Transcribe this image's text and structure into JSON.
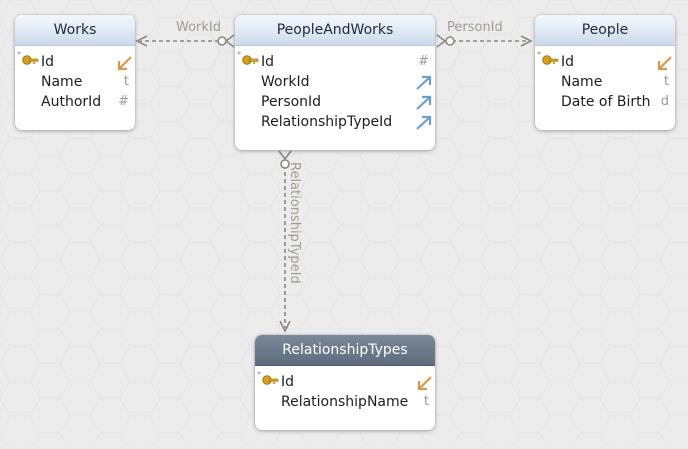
{
  "tables": {
    "works": {
      "title": "Works",
      "fields": [
        {
          "name": "Id",
          "type": "",
          "pk": true
        },
        {
          "name": "Name",
          "type": "t"
        },
        {
          "name": "AuthorId",
          "type": "#"
        }
      ]
    },
    "peopleandworks": {
      "title": "PeopleAndWorks",
      "fields": [
        {
          "name": "Id",
          "type": "#",
          "pk": true
        },
        {
          "name": "WorkId",
          "type": "",
          "fk": true
        },
        {
          "name": "PersonId",
          "type": "",
          "fk": true
        },
        {
          "name": "RelationshipTypeId",
          "type": "",
          "fk": true
        }
      ]
    },
    "people": {
      "title": "People",
      "fields": [
        {
          "name": "Id",
          "type": "",
          "pk": true
        },
        {
          "name": "Name",
          "type": "t"
        },
        {
          "name": "Date of Birth",
          "type": "d"
        }
      ]
    },
    "relationshiptypes": {
      "title": "RelationshipTypes",
      "fields": [
        {
          "name": "Id",
          "type": "",
          "pk": true
        },
        {
          "name": "RelationshipName",
          "type": "t"
        }
      ]
    }
  },
  "relations": {
    "workid": "WorkId",
    "personid": "PersonId",
    "relationshiptypeid": "RelationshipTypeId"
  },
  "colors": {
    "background": "#ececec",
    "edge": "#8c877f",
    "header_light": "#dfe9f5",
    "header_dark": "#5e6d7e",
    "pk_key": "#d6a21d",
    "pk_arrow": "#d79a4c",
    "fk_arrow": "#6a9fd2"
  }
}
